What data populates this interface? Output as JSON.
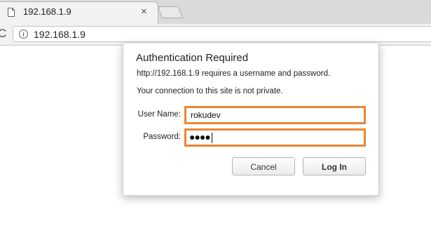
{
  "browser": {
    "tab": {
      "title": "192.168.1.9",
      "close_glyph": "×",
      "icon": "document-icon"
    },
    "toolbar": {
      "reload_glyph": "C",
      "url": "192.168.1.9",
      "info_icon_glyph": "i"
    }
  },
  "dialog": {
    "title": "Authentication Required",
    "message": "http://192.168.1.9 requires a username and password.",
    "privacy_note": "Your connection to this site is not private.",
    "username": {
      "label": "User Name:",
      "value": "rokudev"
    },
    "password": {
      "label": "Password:",
      "value": "●●●●"
    },
    "buttons": {
      "cancel": "Cancel",
      "login": "Log In"
    },
    "highlight_color": "#ee8433"
  }
}
